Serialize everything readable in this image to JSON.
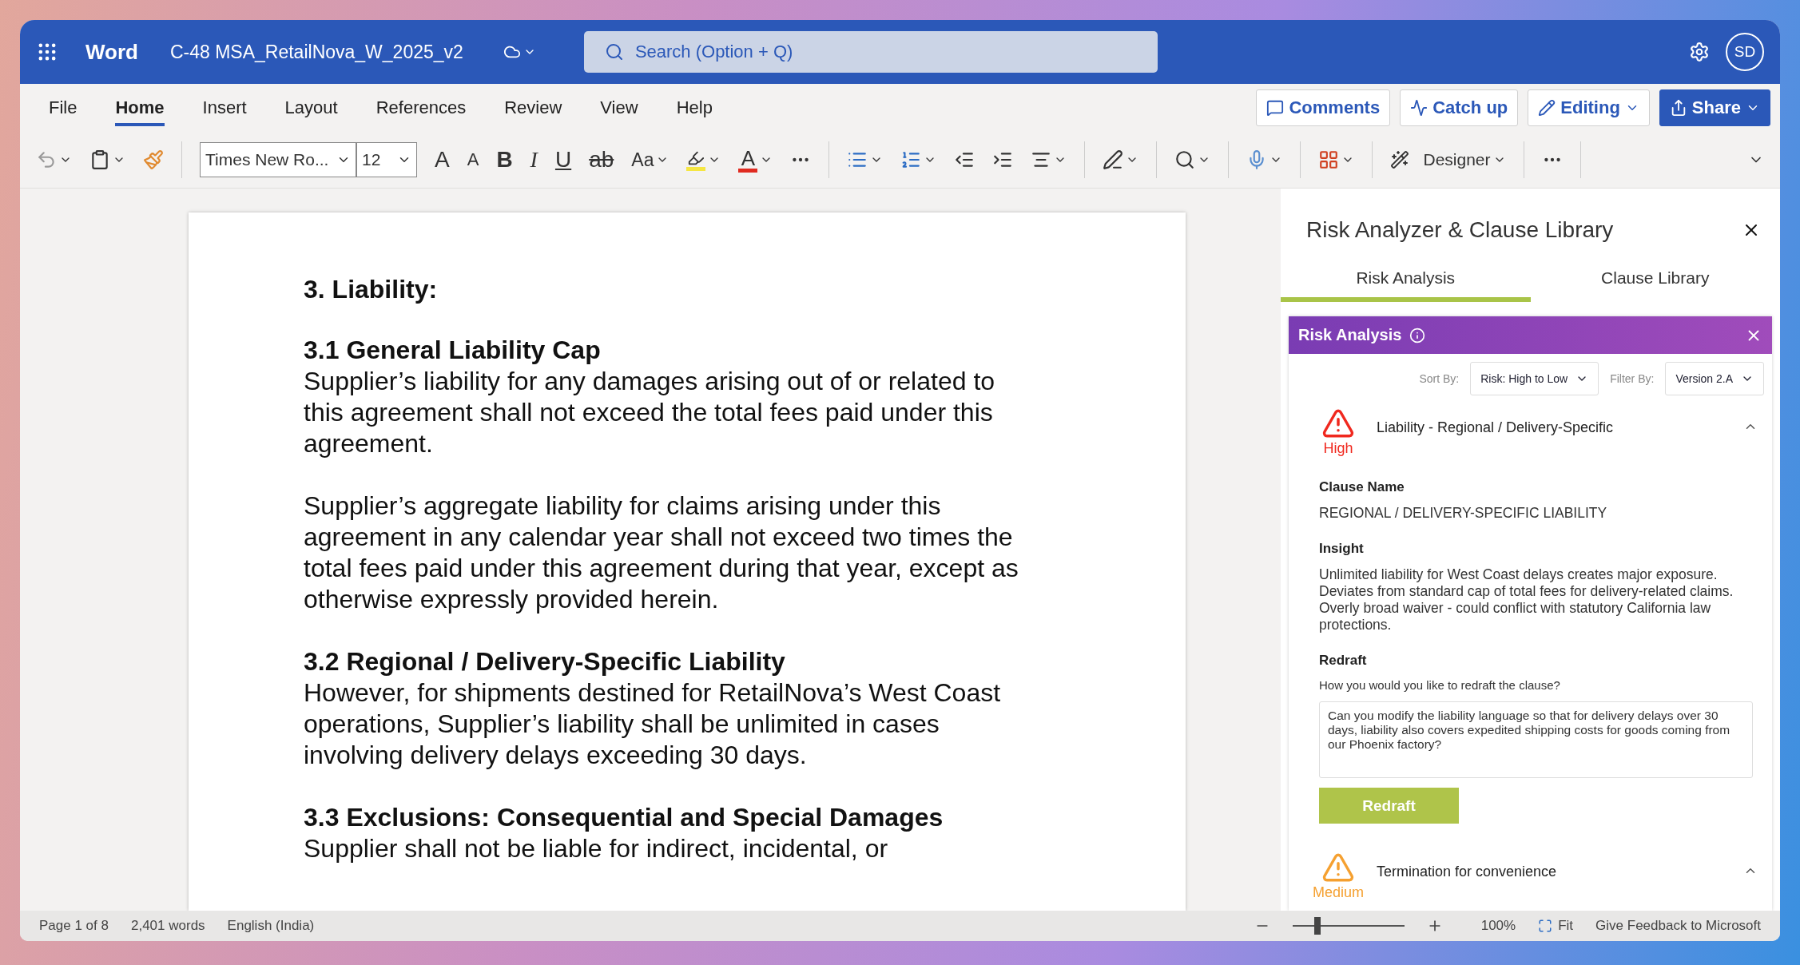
{
  "app": {
    "name": "Word",
    "doc_title": "C-48 MSA_RetailNova_W_2025_v2",
    "search_placeholder": "Search (Option + Q)",
    "avatar": "SD"
  },
  "ribbon_tabs": [
    {
      "label": "File",
      "selected": false
    },
    {
      "label": "Home",
      "selected": true
    },
    {
      "label": "Insert",
      "selected": false
    },
    {
      "label": "Layout",
      "selected": false
    },
    {
      "label": "References",
      "selected": false
    },
    {
      "label": "Review",
      "selected": false
    },
    {
      "label": "View",
      "selected": false
    },
    {
      "label": "Help",
      "selected": false
    }
  ],
  "actions": [
    {
      "label": "Comments",
      "kind": "comments"
    },
    {
      "label": "Catch up",
      "kind": "catchup"
    },
    {
      "label": "Editing",
      "kind": "editing"
    },
    {
      "label": "Share",
      "kind": "share"
    }
  ],
  "toolbar": {
    "font": "Times New Ro...",
    "size": "12",
    "grow": "A",
    "shrink": "A",
    "bold": "B",
    "italic": "I",
    "underline": "U",
    "strike": "ab",
    "case": "Aa",
    "font_color": "A",
    "designer": "Designer"
  },
  "document": [
    {
      "kind": "heading",
      "text": "3. Liability:"
    },
    {
      "kind": "subheading",
      "text": "3.1 General Liability Cap"
    },
    {
      "kind": "para",
      "text": "Supplier’s liability for any damages arising out of or related to this agreement shall not exceed the total fees paid under this agreement."
    },
    {
      "kind": "para",
      "text": "Supplier’s aggregate liability for claims arising under this agreement in any calendar year shall not exceed two times the total fees paid under this agreement during that year, except as otherwise expressly provided herein."
    },
    {
      "kind": "subheading",
      "text": "3.2 Regional / Delivery-Specific Liability"
    },
    {
      "kind": "para",
      "text": "However, for shipments destined for RetailNova’s West Coast operations, Supplier’s liability shall be unlimited in cases involving delivery delays exceeding 30 days."
    },
    {
      "kind": "subheading",
      "text": "3.3 Exclusions: Consequential and Special Damages"
    },
    {
      "kind": "para",
      "text": "Supplier shall not be liable for indirect, incidental, or"
    }
  ],
  "panel": {
    "title": "Risk Analyzer & Clause Library",
    "tabs": [
      {
        "label": "Risk Analysis",
        "selected": true
      },
      {
        "label": "Clause Library",
        "selected": false
      }
    ],
    "banner": "Risk Analysis",
    "sort_label": "Sort By:",
    "sort_value": "Risk: High to Low",
    "filter_label": "Filter By:",
    "filter_value": "Version 2.A",
    "risks": [
      {
        "color": "#f0281e",
        "level": "High",
        "title": "Liability - Regional / Delivery-Specific",
        "expanded": true,
        "clause_name_label": "Clause Name",
        "clause_name": "REGIONAL / DELIVERY-SPECIFIC LIABILITY",
        "insight_label": "Insight",
        "insight": "Unlimited liability for West Coast delays creates major exposure. Deviates from standard cap of total fees for delivery-related claims. Overly broad waiver - could conflict with statutory California law protections.",
        "redraft_label": "Redraft",
        "redraft_prompt": "How you would you like to redraft the clause?",
        "redraft_text": "Can you modify the liability language so that for delivery delays over 30 days, liability also covers expedited shipping costs for goods coming from our Phoenix factory?",
        "button": "Redraft"
      },
      {
        "color": "#f5a030",
        "level": "Medium",
        "title": "Termination for convenience",
        "expanded": true
      }
    ]
  },
  "status_bar": {
    "page": "Page 1 of 8",
    "words": "2,401 words",
    "language": "English (India)",
    "zoom_slider": {
      "level": 0.22
    },
    "zoom": "100%",
    "fit": "Fit",
    "feedback": "Give Feedback to Microsoft"
  }
}
